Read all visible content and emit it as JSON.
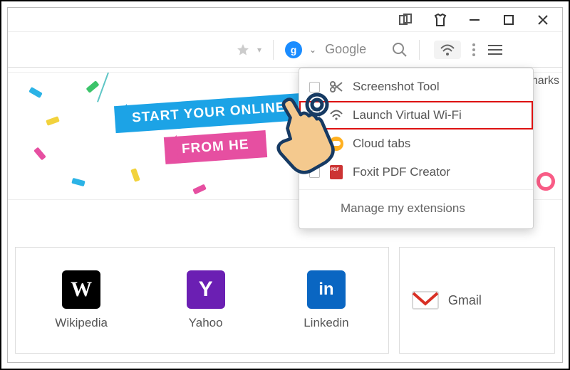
{
  "window": {
    "min": "–",
    "max": "☐",
    "close": "✕"
  },
  "toolbar": {
    "search_engine_glyph": "g",
    "search_text": "Google"
  },
  "bookmarks_peek": "marks",
  "banner": {
    "line1": "START YOUR ONLINE",
    "line2": "FROM HE"
  },
  "extensions_menu": {
    "items": [
      {
        "label": "Screenshot Tool",
        "icon": "scissors",
        "highlight": false
      },
      {
        "label": "Launch Virtual Wi-Fi",
        "icon": "wifi",
        "highlight": true
      },
      {
        "label": "Cloud tabs",
        "icon": "cloud",
        "highlight": false
      },
      {
        "label": "Foxit PDF Creator",
        "icon": "pdf",
        "highlight": false
      }
    ],
    "manage_label": "Manage my extensions"
  },
  "shortcuts": {
    "tiles": [
      {
        "glyph": "W",
        "label": "Wikipedia",
        "cls": "w"
      },
      {
        "glyph": "Y",
        "label": "Yahoo",
        "cls": "y"
      },
      {
        "glyph": "in",
        "label": "Linkedin",
        "cls": "in"
      }
    ],
    "gmail_label": "Gmail"
  }
}
